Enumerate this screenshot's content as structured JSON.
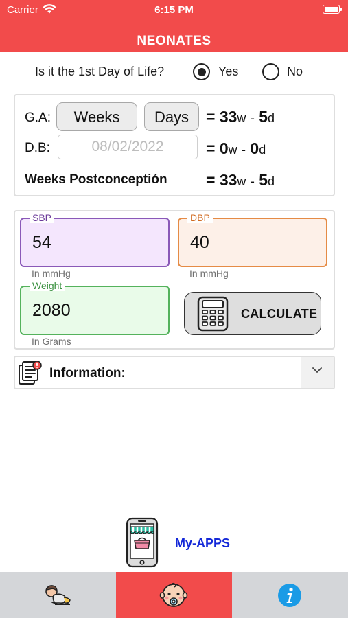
{
  "status_bar": {
    "carrier": "Carrier",
    "time": "6:15 PM"
  },
  "header": {
    "title": "NEONATES"
  },
  "first_day": {
    "question": "Is it the 1st Day of Life?",
    "options": [
      "Yes",
      "No"
    ],
    "selected": "Yes"
  },
  "gestational": {
    "ga_label": "G.A:",
    "weeks_button": "Weeks",
    "days_button": "Days",
    "ga_weeks": "33",
    "ga_days": "5",
    "db_label": "D.B:",
    "db_placeholder": "08/02/2022",
    "db_weeks": "0",
    "db_days": "0",
    "postconception_label": "Weeks Postconceptión",
    "pc_weeks": "33",
    "pc_days": "5",
    "eq": "=",
    "w_unit": "w",
    "d_unit": "d",
    "sep": "-"
  },
  "vitals": {
    "sbp": {
      "label": "SBP",
      "value": "54",
      "hint": "In mmHg"
    },
    "dbp": {
      "label": "DBP",
      "value": "40",
      "hint": "In mmHg"
    },
    "weight": {
      "label": "Weight",
      "value": "2080",
      "hint": "In Grams"
    },
    "calculate_label": "CALCULATE"
  },
  "information": {
    "label": "Information:"
  },
  "my_apps": {
    "label": "My-APPS"
  },
  "tabs": [
    {
      "icon": "baby-crawling-icon",
      "active": false
    },
    {
      "icon": "baby-face-icon",
      "active": true
    },
    {
      "icon": "info-icon",
      "active": false
    }
  ],
  "colors": {
    "accent": "#f24b4b",
    "sbp": "#8a59b8",
    "dbp": "#e58b45",
    "weight": "#54b25c",
    "my_apps": "#1428d8",
    "info_blue": "#1a9be6"
  }
}
